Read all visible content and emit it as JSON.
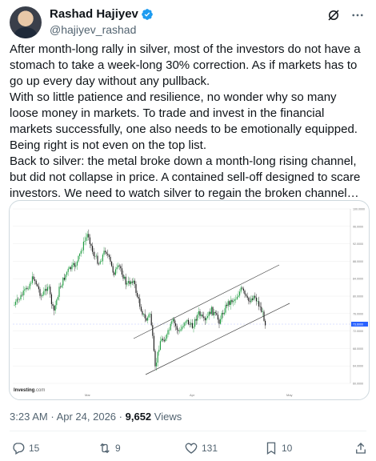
{
  "author": {
    "display_name": "Rashad Hajiyev",
    "handle": "@hajiyev_rashad"
  },
  "tweet": {
    "paragraphs": [
      "After month-long rally in silver, most of the investors do not have a stomach to take a week-long 30% correction. As if markets has to go up every day without any pullback.",
      "With so little patience and resilience, no wonder why so many loose money in markets. To trade and invest in the financial markets successfully, one also needs to be emotionally equipped. Being right is not even on the top list.",
      "Back to silver: the metal broke down a month-long rising channel, but did not collapse in price. A contained sell-off designed to scare investors. We need to watch silver to regain the broken channel…"
    ]
  },
  "chart": {
    "brand": "Investing",
    "brand_suffix": ".com",
    "x_labels": [
      "Mar",
      "Apr",
      "May"
    ],
    "y_labels": [
      "100.0000",
      "96.0000",
      "92.0000",
      "88.0000",
      "84.0000",
      "80.0000",
      "76.0000",
      "72.0000",
      "68.0000",
      "64.0000",
      "60.0000"
    ],
    "last_price": "73.6000",
    "colors": {
      "up": "#1a9a3c",
      "down": "#111111",
      "channel": "#444444",
      "price_tag": "#2962ff"
    }
  },
  "meta": {
    "time": "3:23 AM",
    "sep": "·",
    "date": "Apr 24, 2026",
    "sep2": "·",
    "views_count": "9,652",
    "views_label": "Views"
  },
  "actions": {
    "replies": "15",
    "reposts": "9",
    "likes": "131",
    "bookmarks": "10"
  }
}
